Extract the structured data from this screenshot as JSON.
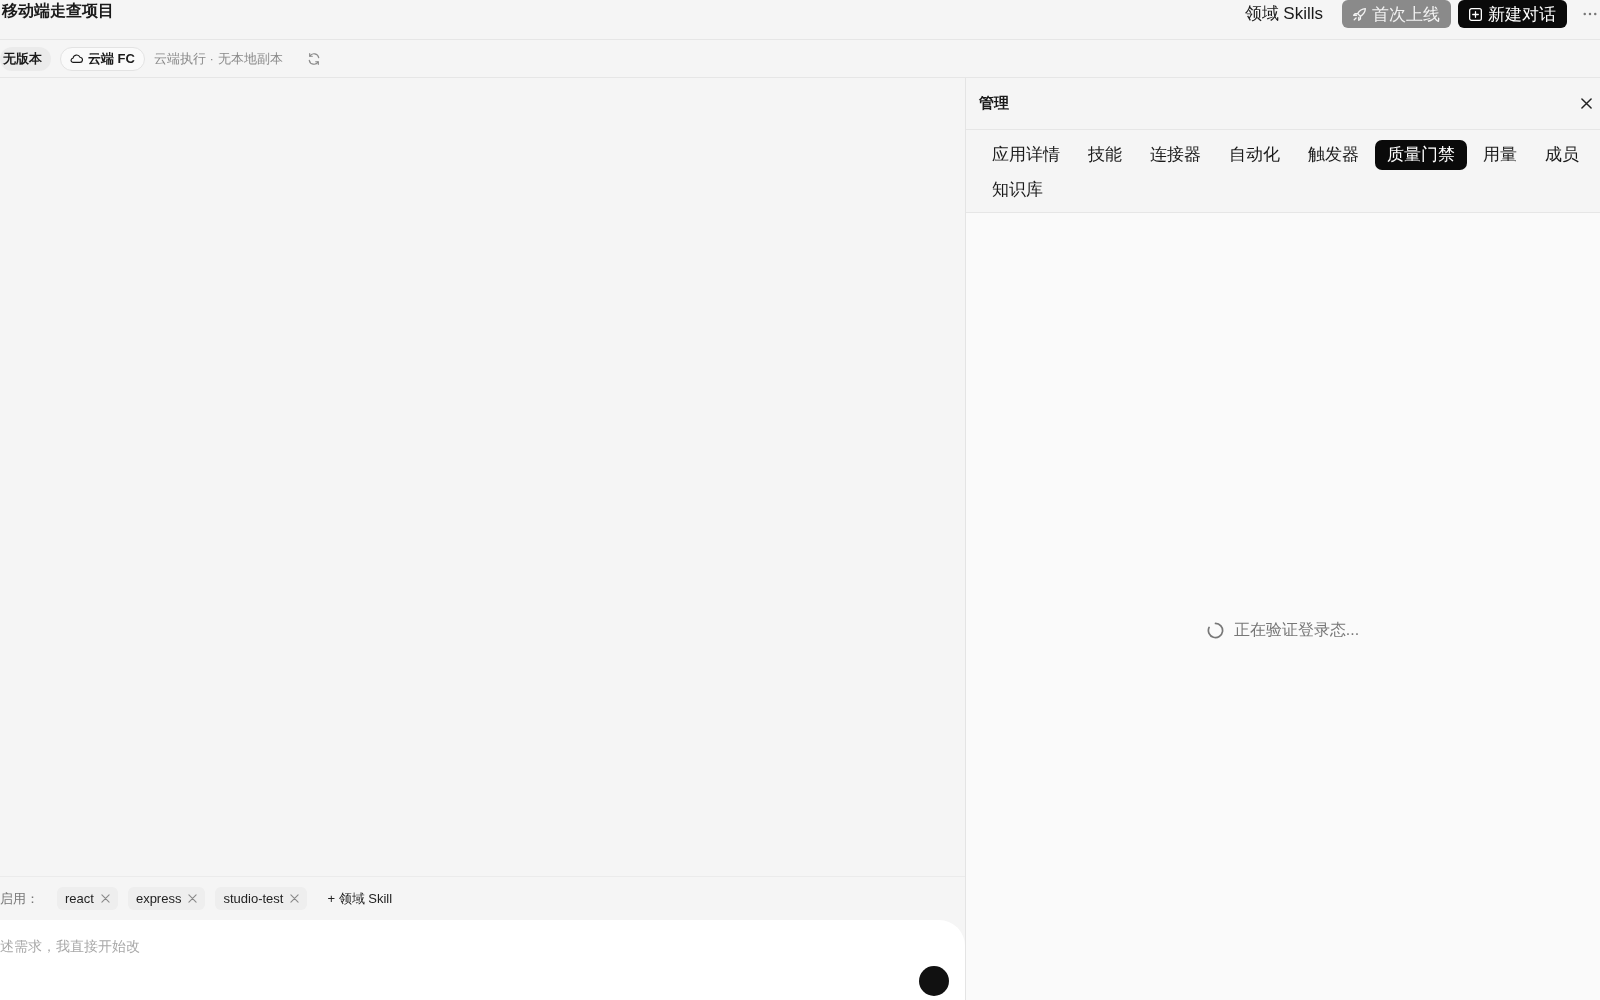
{
  "header": {
    "title": "移动端走查项目",
    "skills_link": "领域 Skills",
    "buttons": [
      {
        "kind": "publish",
        "label": "首次上线",
        "disabled": true
      },
      {
        "kind": "new_chat",
        "label": "新建对话",
        "disabled": false
      }
    ]
  },
  "status_bar": {
    "version_badge": "无版本",
    "runtime_badge": "云端 FC",
    "note": "云端执行 · 无本地副本"
  },
  "panel": {
    "title": "管理",
    "tabs": [
      {
        "label": "应用详情",
        "selected": false
      },
      {
        "label": "技能",
        "selected": false
      },
      {
        "label": "连接器",
        "selected": false
      },
      {
        "label": "自动化",
        "selected": false
      },
      {
        "label": "触发器",
        "selected": false
      },
      {
        "label": "质量门禁",
        "selected": true
      },
      {
        "label": "用量",
        "selected": false
      },
      {
        "label": "成员",
        "selected": false
      },
      {
        "label": "知识库",
        "selected": false
      }
    ],
    "loading_text": "正在验证登录态..."
  },
  "composer": {
    "skills_label": "启用：",
    "skills": [
      {
        "label": "react"
      },
      {
        "label": "express"
      },
      {
        "label": "studio-test"
      }
    ],
    "add_skill": "+ 领域 Skill",
    "placeholder": "述需求，我直接开始改"
  }
}
